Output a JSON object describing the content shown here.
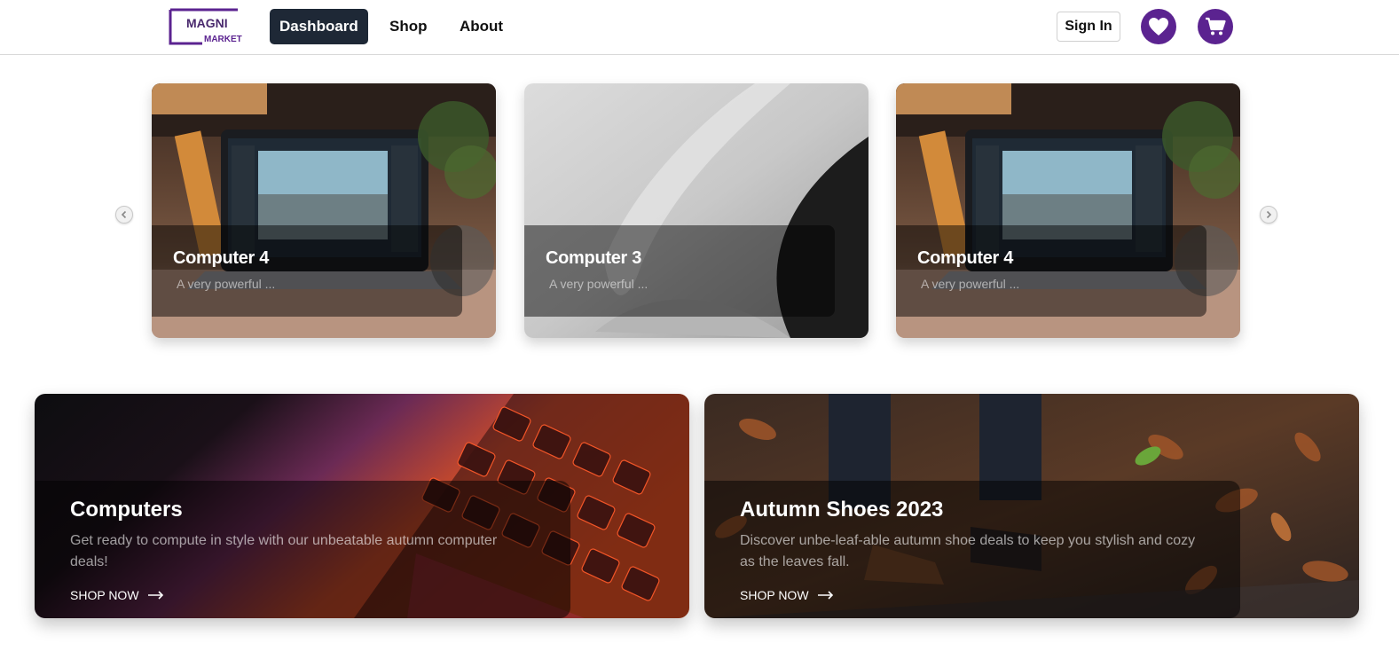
{
  "header": {
    "logo": {
      "line1": "MAGNI",
      "line2": "MARKET"
    },
    "nav": [
      {
        "label": "Dashboard",
        "active": true
      },
      {
        "label": "Shop",
        "active": false
      },
      {
        "label": "About",
        "active": false
      }
    ],
    "sign_in": "Sign In",
    "wishlist_icon": "heart-icon",
    "cart_icon": "cart-icon",
    "accent_color": "#5b2390"
  },
  "carousel": {
    "prev_icon": "chevron-left-icon",
    "next_icon": "chevron-right-icon",
    "items": [
      {
        "title": "Computer 4",
        "description": "A very powerful ..."
      },
      {
        "title": "Computer 3",
        "description": "A very powerful ..."
      },
      {
        "title": "Computer 4",
        "description": "A very powerful ..."
      }
    ]
  },
  "promos": [
    {
      "title": "Computers",
      "description": "Get ready to compute in style with our unbeatable autumn computer deals!",
      "cta": "SHOP NOW"
    },
    {
      "title": "Autumn Shoes 2023",
      "description": "Discover unbe-leaf-able autumn shoe deals to keep you stylish and cozy as the leaves fall.",
      "cta": "SHOP NOW"
    }
  ]
}
